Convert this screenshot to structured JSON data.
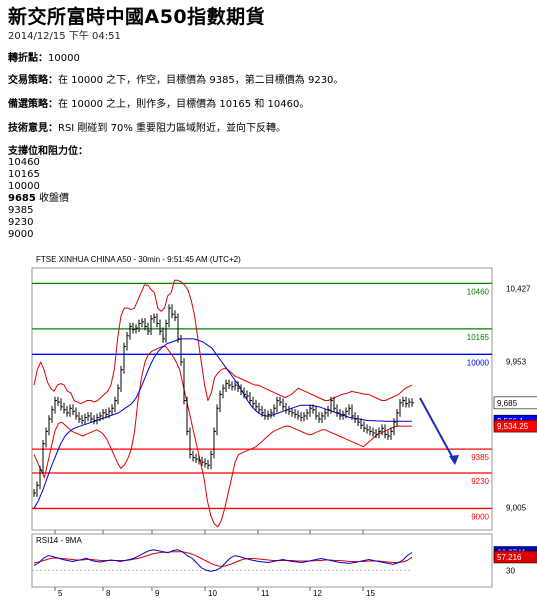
{
  "header": {
    "title": "新交所富時中國A50指數期貨",
    "date": "2014/12/15 下午 04:51"
  },
  "pivot": {
    "label": "轉折點：",
    "value": "10000"
  },
  "strategy": {
    "label": "交易策略：",
    "text": "在 10000 之下，作空，目標價為 9385，第二目標價為 9230。"
  },
  "alt_strategy": {
    "label": "備選策略：",
    "text": "在 10000 之上，則作多，目標價為 10165 和 10460。"
  },
  "comment": {
    "label": "技術意見：",
    "text": "RSI 剛碰到 70% 重要阻力區域附近，並向下反轉。"
  },
  "levels": {
    "title": "支撐位和阻力位：",
    "items": [
      {
        "value": "10460",
        "note": "",
        "bold": false
      },
      {
        "value": "10165",
        "note": "",
        "bold": false
      },
      {
        "value": "10000",
        "note": "",
        "bold": false
      },
      {
        "value": "9685",
        "note": " 收盤價",
        "bold": true
      },
      {
        "value": "9385",
        "note": "",
        "bold": false
      },
      {
        "value": "9230",
        "note": "",
        "bold": false
      },
      {
        "value": "9000",
        "note": "",
        "bold": false
      }
    ]
  },
  "chart_data": {
    "type": "line",
    "title": "FTSE XINHUA CHINA A50 - 30min - 9:51:45 AM (UTC+2)",
    "x_ticks": [
      "5",
      "8",
      "9",
      "10",
      "11",
      "12",
      "15"
    ],
    "y_ticks": [
      "10,427",
      "9,953",
      "9,005"
    ],
    "ylim": [
      8860,
      10560
    ],
    "horizontal_levels": [
      {
        "value": 10460,
        "label": "10460",
        "color": "#008000"
      },
      {
        "value": 10165,
        "label": "10165",
        "color": "#008000"
      },
      {
        "value": 10000,
        "label": "10000",
        "color": "#0000ff"
      },
      {
        "value": 9385,
        "label": "9385",
        "color": "#ff0000"
      },
      {
        "value": 9230,
        "label": "9230",
        "color": "#ff0000"
      },
      {
        "value": 9000,
        "label": "9000",
        "color": "#ff0000"
      }
    ],
    "last_price": {
      "value": 9685,
      "label": "9,685"
    },
    "ma_tag": {
      "value": 9566.1,
      "label": "9,566.1",
      "color": "#0000ff"
    },
    "bb_tag": {
      "value": 9534.25,
      "label": "9,534.25",
      "color": "#ff0000"
    },
    "price_x": [
      0,
      3,
      6,
      9,
      12,
      15,
      18,
      21,
      24,
      27,
      30,
      33,
      36,
      39,
      42,
      45,
      48,
      51,
      54,
      57,
      60,
      63,
      66,
      69,
      72,
      75,
      78,
      81,
      84,
      87,
      90,
      93,
      96,
      99,
      102,
      105,
      108,
      111,
      114,
      117,
      120,
      123,
      126,
      129,
      132,
      135,
      138,
      141,
      144,
      147,
      150,
      153,
      156,
      159,
      162,
      165,
      168,
      171,
      174,
      177,
      180,
      183,
      186,
      189,
      192,
      195,
      198,
      201,
      204,
      207,
      210,
      213,
      216,
      219,
      222,
      225,
      228,
      231,
      234,
      237,
      240,
      243,
      246,
      249,
      252,
      255,
      258,
      261,
      264,
      267,
      270,
      273,
      276,
      279,
      282,
      285,
      288,
      291,
      294,
      297,
      300,
      303,
      306,
      309,
      312,
      315,
      318,
      321,
      324,
      327,
      330,
      333,
      336,
      339,
      342,
      345,
      348,
      351,
      354,
      357,
      360,
      363,
      366,
      369,
      372,
      375,
      378
    ],
    "price_values": [
      9100,
      9150,
      9250,
      9420,
      9500,
      9580,
      9640,
      9700,
      9690,
      9660,
      9640,
      9620,
      9650,
      9630,
      9600,
      9580,
      9570,
      9590,
      9600,
      9580,
      9570,
      9590,
      9600,
      9620,
      9610,
      9630,
      9650,
      9700,
      9780,
      9900,
      10050,
      10120,
      10180,
      10160,
      10170,
      10200,
      10210,
      10180,
      10150,
      10230,
      10240,
      10200,
      10150,
      10100,
      10200,
      10300,
      10260,
      10240,
      10100,
      9950,
      9700,
      9500,
      9350,
      9330,
      9320,
      9310,
      9300,
      9290,
      9280,
      9350,
      9500,
      9650,
      9740,
      9780,
      9810,
      9800,
      9790,
      9800,
      9780,
      9760,
      9740,
      9730,
      9700,
      9680,
      9660,
      9640,
      9620,
      9600,
      9610,
      9620,
      9650,
      9700,
      9690,
      9660,
      9640,
      9630,
      9620,
      9610,
      9600,
      9590,
      9600,
      9620,
      9650,
      9640,
      9600,
      9580,
      9600,
      9620,
      9640,
      9700,
      9650,
      9620,
      9600,
      9610,
      9630,
      9650,
      9600,
      9580,
      9560,
      9540,
      9520,
      9510,
      9500,
      9490,
      9480,
      9500,
      9520,
      9480,
      9470,
      9500,
      9560,
      9620,
      9685,
      9700,
      9680,
      9690,
      9685
    ],
    "bb_upper": [
      9800,
      9900,
      9950,
      9900,
      9820,
      9780,
      9760,
      9800,
      9810,
      9800,
      9760,
      9750,
      9700,
      9690,
      9680,
      9690,
      9700,
      9700,
      9690,
      9700,
      9720,
      9740,
      9760,
      9800,
      9900,
      10100,
      10250,
      10300,
      10300,
      10290,
      10300,
      10350,
      10400,
      10450,
      10450,
      10420,
      10400,
      10300,
      10280,
      10300,
      10380,
      10400,
      10480,
      10480,
      10470,
      10450,
      10420,
      10350,
      10250,
      10100,
      9950,
      9800,
      9700,
      9750,
      9850,
      9880,
      9900,
      9910,
      9900,
      9880,
      9860,
      9850,
      9840,
      9830,
      9820,
      9810,
      9800,
      9800,
      9790,
      9780,
      9770,
      9760,
      9750,
      9740,
      9730,
      9720,
      9730,
      9740,
      9760,
      9780,
      9770,
      9760,
      9750,
      9740,
      9730,
      9720,
      9710,
      9700,
      9700,
      9710,
      9720,
      9730,
      9740,
      9745,
      9750,
      9760,
      9755,
      9750,
      9745,
      9740,
      9740,
      9730,
      9720,
      9710,
      9700,
      9700,
      9710,
      9720,
      9730,
      9740,
      9760,
      9780,
      9790,
      9800
    ],
    "bb_lower": [
      9350,
      9300,
      9250,
      9200,
      9300,
      9400,
      9500,
      9550,
      9560,
      9540,
      9520,
      9500,
      9490,
      9480,
      9470,
      9480,
      9490,
      9500,
      9510,
      9500,
      9480,
      9450,
      9400,
      9350,
      9300,
      9260,
      9280,
      9320,
      9380,
      9500,
      9700,
      9850,
      9950,
      10000,
      10020,
      10030,
      10040,
      10050,
      10050,
      10020,
      9990,
      9950,
      9900,
      9800,
      9700,
      9600,
      9500,
      9400,
      9300,
      9200,
      9050,
      8950,
      8900,
      8880,
      8920,
      9000,
      9100,
      9200,
      9300,
      9350,
      9360,
      9370,
      9380,
      9390,
      9400,
      9420,
      9440,
      9460,
      9480,
      9500,
      9510,
      9520,
      9530,
      9535,
      9530,
      9520,
      9510,
      9500,
      9490,
      9480,
      9480,
      9490,
      9500,
      9510,
      9510,
      9500,
      9490,
      9480,
      9470,
      9460,
      9450,
      9440,
      9430,
      9420,
      9410,
      9400,
      9420,
      9440,
      9460,
      9480,
      9490,
      9500,
      9510,
      9520,
      9530,
      9534,
      9534,
      9533,
      9534,
      9534
    ],
    "ma_values": [
      9000,
      9050,
      9120,
      9200,
      9280,
      9350,
      9420,
      9470,
      9500,
      9520,
      9530,
      9540,
      9550,
      9560,
      9570,
      9580,
      9590,
      9600,
      9610,
      9620,
      9640,
      9660,
      9680,
      9720,
      9780,
      9850,
      9920,
      9980,
      10020,
      10050,
      10070,
      10080,
      10090,
      10100,
      10100,
      10100,
      10100,
      10090,
      10080,
      10060,
      10040,
      10000,
      9960,
      9920,
      9880,
      9840,
      9800,
      9750,
      9700,
      9660,
      9630,
      9610,
      9600,
      9600,
      9610,
      9620,
      9630,
      9640,
      9650,
      9660,
      9670,
      9670,
      9670,
      9665,
      9660,
      9650,
      9640,
      9630,
      9620,
      9610,
      9600,
      9590,
      9585,
      9580,
      9575,
      9570,
      9570,
      9568,
      9567,
      9566,
      9566,
      9566,
      9566,
      9566,
      9566,
      9566.1
    ],
    "rsi": {
      "label": "RSI14 - 9MA",
      "value": 66.2741,
      "value_label": "66.2741",
      "ma_value": 57.216,
      "ma_label": "57.216",
      "low_level": 30,
      "low_label": "30",
      "values": [
        40,
        45,
        55,
        60,
        58,
        55,
        52,
        50,
        48,
        50,
        52,
        55,
        50,
        48,
        47,
        49,
        51,
        50,
        48,
        50,
        52,
        55,
        60,
        65,
        70,
        72,
        70,
        68,
        66,
        70,
        72,
        68,
        60,
        55,
        45,
        35,
        30,
        28,
        30,
        35,
        45,
        55,
        60,
        58,
        55,
        52,
        50,
        48,
        47,
        46,
        48,
        50,
        52,
        50,
        48,
        47,
        46,
        48,
        50,
        52,
        54,
        52,
        50,
        48,
        46,
        45,
        44,
        46,
        48,
        50,
        52,
        50,
        48,
        46,
        44,
        42,
        45,
        50,
        60,
        66.2741
      ],
      "ma_values": [
        45,
        47,
        50,
        53,
        55,
        55,
        54,
        53,
        52,
        51,
        51,
        52,
        52,
        51,
        50,
        50,
        50,
        50,
        50,
        50,
        51,
        53,
        55,
        58,
        61,
        64,
        66,
        67,
        67,
        68,
        68,
        68,
        66,
        63,
        59,
        54,
        49,
        44,
        40,
        38,
        39,
        42,
        46,
        50,
        53,
        54,
        54,
        53,
        52,
        51,
        50,
        50,
        50,
        50,
        50,
        49,
        49,
        49,
        49,
        50,
        50,
        51,
        51,
        50,
        50,
        49,
        48,
        48,
        48,
        48,
        49,
        49,
        49,
        48,
        47,
        46,
        46,
        47,
        50,
        57.216
      ]
    }
  }
}
